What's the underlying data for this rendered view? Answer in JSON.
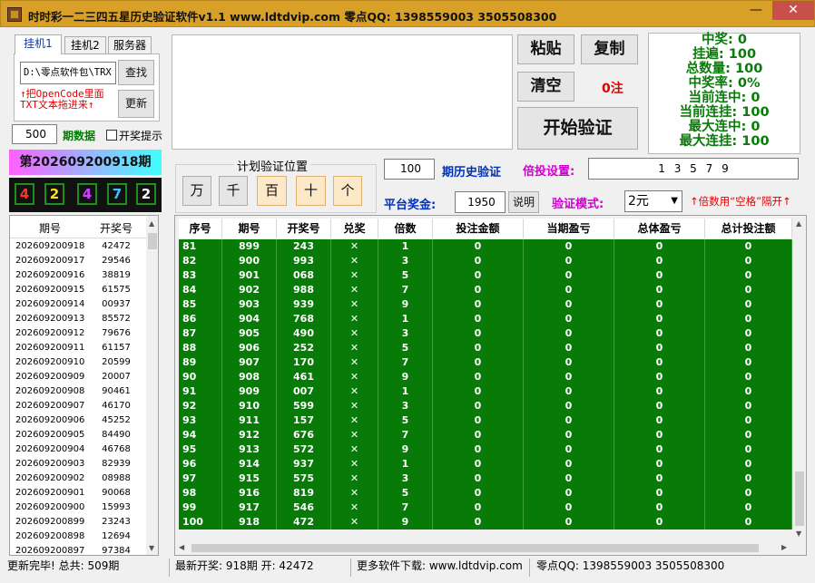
{
  "window": {
    "title": "时时彩一二三四五星历史验证软件v1.1    www.ldtdvip.com    零点QQ:  1398559003  3505508300",
    "min_glyph": "—",
    "max_glyph": "☐",
    "close_glyph": "✕"
  },
  "tabs": {
    "tab1": "挂机1",
    "tab2": "挂机2",
    "tab3": "服务器"
  },
  "path_field": {
    "value": "D:\\零点软件包\\TRX"
  },
  "buttons": {
    "find": "查找",
    "update": "更新",
    "paste": "粘贴",
    "copy": "复制",
    "clear": "清空",
    "start": "开始验证",
    "explain": "说明"
  },
  "hint_red": {
    "line1": "↑把OpenCode里面",
    "line2": "TXT文本拖进来↑"
  },
  "period_count": {
    "value": "500",
    "label": "期数据"
  },
  "lottery_hint_label": "开奖提示",
  "current_period": "第202609200918期",
  "digits": [
    "4",
    "2",
    "4",
    "7",
    "2"
  ],
  "digit_colors": [
    "#ff3030",
    "#ffe020",
    "#d040ff",
    "#40c0ff",
    "#ffffff"
  ],
  "plan_box": {
    "title": "计划验证位置",
    "positions": [
      "万",
      "千",
      "百",
      "十",
      "个"
    ]
  },
  "bet_zero": "0注",
  "stats": [
    "中奖: 0",
    "挂遍: 100",
    "总数量: 100",
    "中奖率: 0%",
    "当前连中: 0",
    "当前连挂: 100",
    "最大连中: 0",
    "最大连挂: 100"
  ],
  "history": {
    "value": "100",
    "label": "期历史验证"
  },
  "bet_setting": {
    "label": "倍投设置:",
    "value": "1 3 5 7 9"
  },
  "platform": {
    "label": "平台奖金:",
    "value": "1950"
  },
  "verify_mode": {
    "label": "验证模式:",
    "value": "2元"
  },
  "multiplier_hint": "↑倍数用“空格”隔开↑",
  "left_table": {
    "headers": [
      "期号",
      "开奖号"
    ],
    "rows": [
      [
        "202609200918",
        "42472"
      ],
      [
        "202609200917",
        "29546"
      ],
      [
        "202609200916",
        "38819"
      ],
      [
        "202609200915",
        "61575"
      ],
      [
        "202609200914",
        "00937"
      ],
      [
        "202609200913",
        "85572"
      ],
      [
        "202609200912",
        "79676"
      ],
      [
        "202609200911",
        "61157"
      ],
      [
        "202609200910",
        "20599"
      ],
      [
        "202609200909",
        "20007"
      ],
      [
        "202609200908",
        "90461"
      ],
      [
        "202609200907",
        "46170"
      ],
      [
        "202609200906",
        "45252"
      ],
      [
        "202609200905",
        "84490"
      ],
      [
        "202609200904",
        "46768"
      ],
      [
        "202609200903",
        "82939"
      ],
      [
        "202609200902",
        "08988"
      ],
      [
        "202609200901",
        "90068"
      ],
      [
        "202609200900",
        "15993"
      ],
      [
        "202609200899",
        "23243"
      ],
      [
        "202609200898",
        "12694"
      ],
      [
        "202609200897",
        "97384"
      ]
    ]
  },
  "main_table": {
    "headers": [
      "序号",
      "期号",
      "开奖号",
      "兑奖",
      "倍数",
      "投注金额",
      "当期盈亏",
      "总体盈亏",
      "总计投注额"
    ],
    "rows": [
      [
        "81",
        "899",
        "243",
        "✕",
        "1",
        "0",
        "0",
        "0",
        "0"
      ],
      [
        "82",
        "900",
        "993",
        "✕",
        "3",
        "0",
        "0",
        "0",
        "0"
      ],
      [
        "83",
        "901",
        "068",
        "✕",
        "5",
        "0",
        "0",
        "0",
        "0"
      ],
      [
        "84",
        "902",
        "988",
        "✕",
        "7",
        "0",
        "0",
        "0",
        "0"
      ],
      [
        "85",
        "903",
        "939",
        "✕",
        "9",
        "0",
        "0",
        "0",
        "0"
      ],
      [
        "86",
        "904",
        "768",
        "✕",
        "1",
        "0",
        "0",
        "0",
        "0"
      ],
      [
        "87",
        "905",
        "490",
        "✕",
        "3",
        "0",
        "0",
        "0",
        "0"
      ],
      [
        "88",
        "906",
        "252",
        "✕",
        "5",
        "0",
        "0",
        "0",
        "0"
      ],
      [
        "89",
        "907",
        "170",
        "✕",
        "7",
        "0",
        "0",
        "0",
        "0"
      ],
      [
        "90",
        "908",
        "461",
        "✕",
        "9",
        "0",
        "0",
        "0",
        "0"
      ],
      [
        "91",
        "909",
        "007",
        "✕",
        "1",
        "0",
        "0",
        "0",
        "0"
      ],
      [
        "92",
        "910",
        "599",
        "✕",
        "3",
        "0",
        "0",
        "0",
        "0"
      ],
      [
        "93",
        "911",
        "157",
        "✕",
        "5",
        "0",
        "0",
        "0",
        "0"
      ],
      [
        "94",
        "912",
        "676",
        "✕",
        "7",
        "0",
        "0",
        "0",
        "0"
      ],
      [
        "95",
        "913",
        "572",
        "✕",
        "9",
        "0",
        "0",
        "0",
        "0"
      ],
      [
        "96",
        "914",
        "937",
        "✕",
        "1",
        "0",
        "0",
        "0",
        "0"
      ],
      [
        "97",
        "915",
        "575",
        "✕",
        "3",
        "0",
        "0",
        "0",
        "0"
      ],
      [
        "98",
        "916",
        "819",
        "✕",
        "5",
        "0",
        "0",
        "0",
        "0"
      ],
      [
        "99",
        "917",
        "546",
        "✕",
        "7",
        "0",
        "0",
        "0",
        "0"
      ],
      [
        "100",
        "918",
        "472",
        "✕",
        "9",
        "0",
        "0",
        "0",
        "0"
      ]
    ]
  },
  "status_bar": {
    "left": "更新完毕! 总共: 509期",
    "latest": "最新开奖: 918期 开: 42472",
    "download": "更多软件下载: www.ldtdvip.com",
    "qq": "零点QQ: 1398559003  3505508300"
  },
  "colors": {
    "title_bar": "#d9a028",
    "green_row": "#077a07",
    "current_period_gradient_left": "#ff60ff",
    "current_period_gradient_right": "#40ffff",
    "red_text": "#e00000",
    "blue_label": "#0030c0",
    "magenta_label": "#d000d0"
  }
}
